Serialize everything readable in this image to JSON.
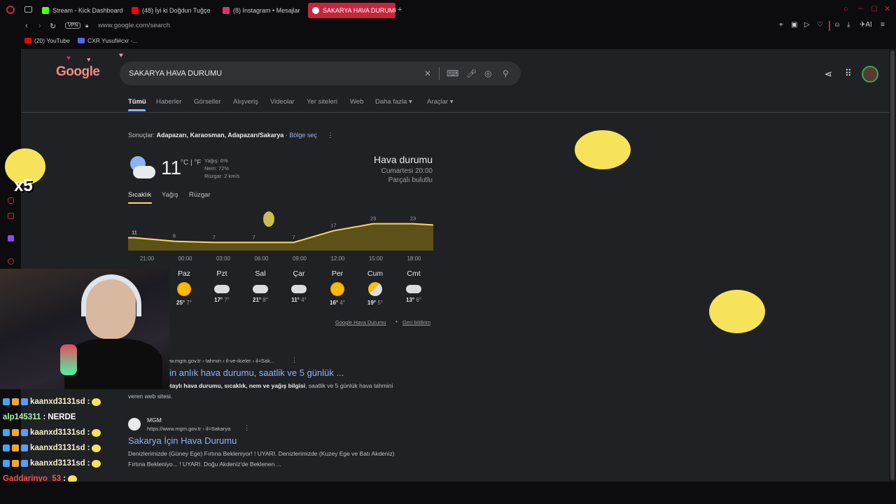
{
  "browser": {
    "tabs": [
      {
        "label": "Stream - Kick Dashboard",
        "color": "#53fc18"
      },
      {
        "label": "(48) İyi ki Doğdun Tuğçe",
        "color": "#ff0000"
      },
      {
        "label": "(8) Instagram • Mesajlar",
        "color": "#e1306c"
      },
      {
        "label": "SAKARYA HAVA DURUMU",
        "color": "#ffffff"
      }
    ],
    "vpn": "VPN",
    "url": "www.google.com/search",
    "bookmarks": [
      "(20) YouTube",
      "CXR Yusufi#cxr -..."
    ],
    "ai_label": "AI"
  },
  "search": {
    "logo": "Google",
    "query": "SAKARYA HAVA DURUMU",
    "tabs": [
      "Tümü",
      "Haberler",
      "Görseller",
      "Alışveriş",
      "Videolar",
      "Yer siteleri",
      "Web",
      "Daha fazla",
      "Araçlar"
    ],
    "results_prefix": "Sonuçlar:",
    "results_location": "Adapazarı, Karaosman, Adapazarı/Sakarya",
    "region_link": "Bölge seç"
  },
  "weather": {
    "temp": "11",
    "unit": "°C | °F",
    "precip": "Yağış: 6%",
    "humidity": "Nem: 72%",
    "wind": "Rüzgar: 2 km/s",
    "title": "Hava durumu",
    "time": "Cumartesi 20:00",
    "condition": "Parçalı bulutlu",
    "tabs": [
      "Sıcaklık",
      "Yağış",
      "Rüzgar"
    ],
    "chart_data": {
      "type": "area",
      "x": [
        "21:00",
        "00:00",
        "03:00",
        "06:00",
        "09:00",
        "12:00",
        "15:00",
        "18:00"
      ],
      "points": [
        {
          "x": "21:00",
          "label": "11",
          "y": 11
        },
        {
          "x": "00:00",
          "label": "8",
          "y": 8
        },
        {
          "x": "03:00",
          "label": "7",
          "y": 7
        },
        {
          "x": "06:00",
          "label": "7",
          "y": 7
        },
        {
          "x": "09:00",
          "label": "7",
          "y": 7
        },
        {
          "x": "12:00",
          "label": "17",
          "y": 17
        },
        {
          "x": "15:00",
          "label": "23",
          "y": 23
        },
        {
          "x": "18:00",
          "label": "23",
          "y": 23
        }
      ],
      "color": "#fdd663"
    },
    "days": [
      {
        "name": "Paz",
        "high": "25°",
        "low": "7°",
        "icon": "sun"
      },
      {
        "name": "Pzt",
        "high": "17°",
        "low": "7°",
        "icon": "cloud"
      },
      {
        "name": "Sal",
        "high": "21°",
        "low": "8°",
        "icon": "cloud"
      },
      {
        "name": "Çar",
        "high": "11°",
        "low": "4°",
        "icon": "cloud"
      },
      {
        "name": "Per",
        "high": "16°",
        "low": "4°",
        "icon": "sun"
      },
      {
        "name": "Cum",
        "high": "19°",
        "low": "5°",
        "icon": "suncloud"
      },
      {
        "name": "Cmt",
        "high": "13°",
        "low": "6°",
        "icon": "cloud"
      }
    ],
    "source_link": "Google Hava Durumu",
    "feedback_link": "Geri bildirim"
  },
  "results": [
    {
      "url": "www.mgm.gov.tr › tahmin › il-ve-ilceler › il=Sak...",
      "title": "in anlık hava durumu, saatlik ve 5 günlük ...",
      "snippet_bold": "detaylı hava durumu, sıcaklık, nem ve yağış bilgisi",
      "snippet": ", saatlik ve 5 günlük hava tahmini",
      "snippet2": "veren web sitesi."
    },
    {
      "site": "MGM",
      "url": "https://www.mgm.gov.tr › il=Sakarya",
      "title": "Sakarya İçin Hava Durumu",
      "snippet": "Denizlerimizde (Güney Ege) Fırtına Bekleniyor! ! UYARI. Denizlerimizde (Kuzey Ege ve Batı Akdeniz)",
      "snippet2": "Fırtına Bekleniyo... ! UYARI. Doğu Akdeniz'de Beklenen ..."
    }
  ],
  "overlay": {
    "multiplier": "x5",
    "chat": [
      {
        "user": "kaanxd3131sd",
        "msg": "",
        "color": "#f5f0c8"
      },
      {
        "user": "alp145311",
        "msg": "NERDE",
        "color": "#a8f5a8"
      },
      {
        "user": "kaanxd3131sd",
        "msg": "",
        "color": "#f5f0c8"
      },
      {
        "user": "kaanxd3131sd",
        "msg": "",
        "color": "#f5f0c8"
      },
      {
        "user": "kaanxd3131sd",
        "msg": "",
        "color": "#f5f0c8"
      },
      {
        "user": "Gaddarinyo_53",
        "msg": "",
        "color": "#ff4d4d"
      },
      {
        "user": "Gaddarinyo_53",
        "msg": "",
        "color": "#ff4d4d"
      }
    ]
  }
}
